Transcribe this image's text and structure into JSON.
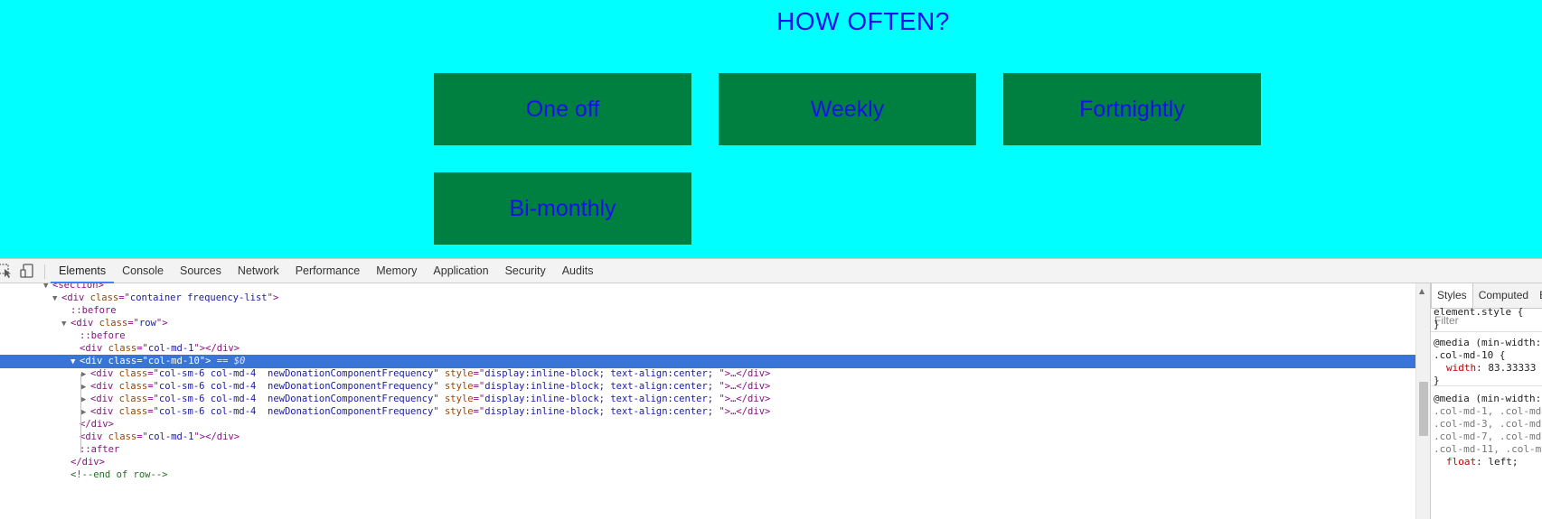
{
  "page": {
    "title": "HOW OFTEN?",
    "frequency_options": [
      "One off",
      "Weekly",
      "Fortnightly",
      "Bi-monthly"
    ],
    "colors": {
      "background": "#00ffff",
      "button": "#008040",
      "text": "#1a10e8"
    }
  },
  "devtools": {
    "icons": [
      "inspect-icon",
      "device-toggle-icon"
    ],
    "tabs": [
      "Elements",
      "Console",
      "Sources",
      "Network",
      "Performance",
      "Memory",
      "Application",
      "Security",
      "Audits"
    ],
    "active_tab": "Elements",
    "elements_tree": [
      {
        "tri": "▼",
        "open": "<section>"
      },
      {
        "tri": "▼",
        "tag": "div",
        "attrs": [
          {
            "n": "class",
            "v": "container frequency-list"
          }
        ]
      },
      {
        "pseudo": "::before"
      },
      {
        "tri": "▼",
        "tag": "div",
        "attrs": [
          {
            "n": "class",
            "v": "row"
          }
        ]
      },
      {
        "pseudo": "::before"
      },
      {
        "tag": "div",
        "attrs": [
          {
            "n": "class",
            "v": "col-md-1"
          }
        ],
        "closed": "</div>"
      },
      {
        "tri": "▼",
        "tag": "div",
        "attrs": [
          {
            "n": "class",
            "v": "col-md-10"
          }
        ],
        "suffix": " == $0",
        "selected": true
      },
      {
        "tri": "▶",
        "tag": "div",
        "attrs": [
          {
            "n": "class",
            "v": "col-sm-6 col-md-4  newDonationComponentFrequency"
          },
          {
            "n": "style",
            "v": "display:inline-block; text-align:center; "
          }
        ],
        "collapsed": "…</div>"
      },
      {
        "tri": "▶",
        "tag": "div",
        "attrs": [
          {
            "n": "class",
            "v": "col-sm-6 col-md-4  newDonationComponentFrequency"
          },
          {
            "n": "style",
            "v": "display:inline-block; text-align:center; "
          }
        ],
        "collapsed": "…</div>"
      },
      {
        "tri": "▶",
        "tag": "div",
        "attrs": [
          {
            "n": "class",
            "v": "col-sm-6 col-md-4  newDonationComponentFrequency"
          },
          {
            "n": "style",
            "v": "display:inline-block; text-align:center; "
          }
        ],
        "collapsed": "…</div>"
      },
      {
        "tri": "▶",
        "tag": "div",
        "attrs": [
          {
            "n": "class",
            "v": "col-sm-6 col-md-4  newDonationComponentFrequency"
          },
          {
            "n": "style",
            "v": "display:inline-block; text-align:center; "
          }
        ],
        "collapsed": "…</div>"
      },
      {
        "close": "</div>"
      },
      {
        "tag": "div",
        "attrs": [
          {
            "n": "class",
            "v": "col-md-1"
          }
        ],
        "closed": "</div>"
      },
      {
        "pseudo": "::after"
      },
      {
        "close": "</div>"
      },
      {
        "comment": "<!--end of row-->"
      }
    ],
    "styles": {
      "tabs": [
        "Styles",
        "Computed",
        "E"
      ],
      "filter_placeholder": "Filter",
      "rules": [
        {
          "text": "element.style {",
          "dim": false
        },
        {
          "text": "}",
          "dim": false
        },
        {
          "text": "@media (min-width:",
          "dim": false
        },
        {
          "text": ".col-md-10 {",
          "dim": false
        },
        {
          "prop": "width",
          "value": ": 83.33333"
        },
        {
          "text": "}",
          "dim": false
        },
        {
          "text": "@media (min-width:",
          "dim": false
        },
        {
          "text": ".col-md-1, .col-md",
          "dim": true
        },
        {
          "text": ".col-md-3, .col-md",
          "dim": true
        },
        {
          "text": ".col-md-7, .col-md",
          "dim": true
        },
        {
          "text": ".col-md-11, .col-m",
          "dim": true
        },
        {
          "prop": "float",
          "value": ": left;"
        }
      ]
    }
  }
}
